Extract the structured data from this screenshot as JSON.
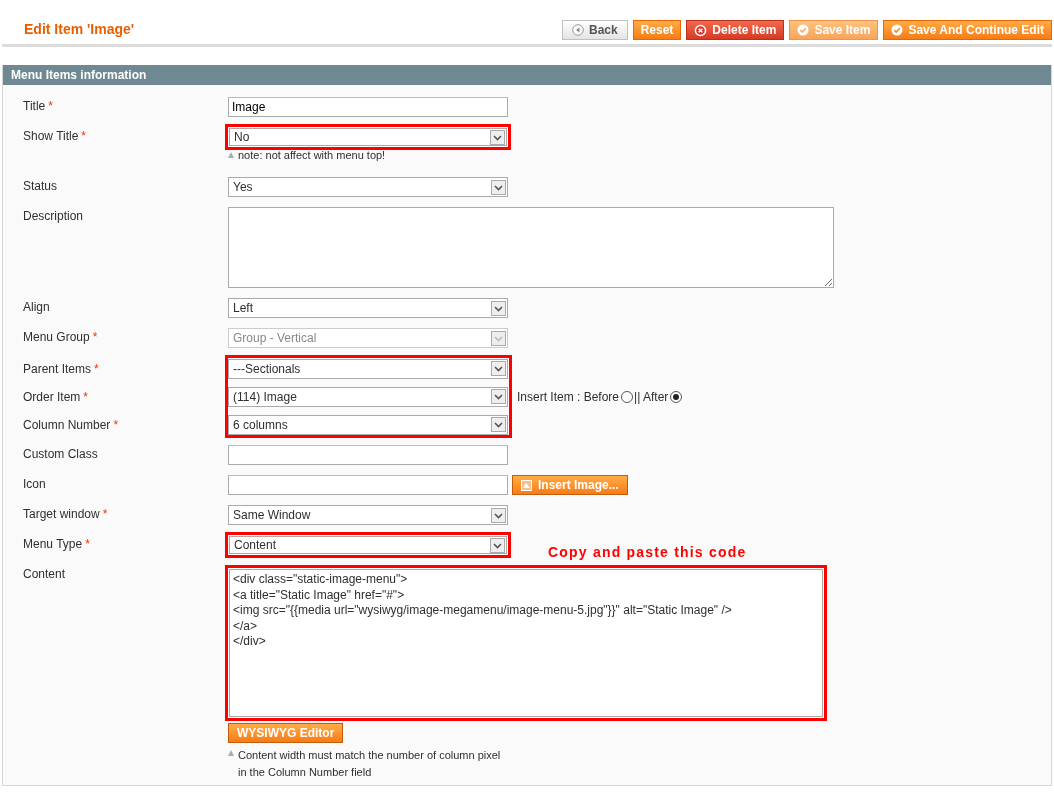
{
  "page_title": "Edit Item 'Image'",
  "buttons": [
    {
      "label": "Back",
      "kind": "back"
    },
    {
      "label": "Reset",
      "kind": "plain"
    },
    {
      "label": "Delete Item",
      "kind": "delete"
    },
    {
      "label": "Save Item",
      "kind": "save",
      "disabled": true
    },
    {
      "label": "Save And Continue Edit",
      "kind": "save",
      "disabled": false
    }
  ],
  "section_title": "Menu Items information",
  "fields": [
    {
      "kind": "text",
      "label": "Title",
      "required_mark": "*",
      "value": "Image",
      "highlighted": false
    },
    {
      "kind": "select",
      "label": "Show Title",
      "required_mark": "*",
      "value": "No",
      "highlighted": true,
      "note": "note: not affect with menu top!"
    },
    {
      "kind": "select",
      "label": "Status",
      "value": "Yes",
      "highlighted": false
    },
    {
      "kind": "textarea",
      "label": "Description",
      "highlighted": false
    },
    {
      "kind": "select",
      "label": "Align",
      "value": "Left",
      "highlighted": false
    },
    {
      "kind": "select",
      "label": "Menu Group",
      "required_mark": "*",
      "value": "Group - Vertical",
      "highlighted": false,
      "disabled": true
    },
    {
      "kind": "group",
      "highlighted": true,
      "children": [
        {
          "kind": "select",
          "label": "Parent Items",
          "required_mark": "*",
          "value": "---Sectionals"
        },
        {
          "kind": "select",
          "label": "Order Item",
          "required_mark": "*",
          "value": "(114) Image",
          "insert": {
            "label": "Insert Item : Before",
            "separator": "|| After",
            "options": [
              {
                "selected": false
              },
              {
                "selected": true
              }
            ]
          }
        },
        {
          "kind": "select",
          "label": "Column Number",
          "required_mark": "*",
          "value": "6 columns"
        }
      ]
    },
    {
      "kind": "text",
      "label": "Custom Class",
      "highlighted": false
    },
    {
      "kind": "text",
      "label": "Icon",
      "highlighted": false,
      "button": "Insert Image..."
    },
    {
      "kind": "select",
      "label": "Target window",
      "required_mark": "*",
      "value": "Same Window",
      "highlighted": false
    },
    {
      "kind": "select",
      "label": "Menu Type",
      "required_mark": "*",
      "value": "Content",
      "highlighted": true
    },
    {
      "kind": "code",
      "label": "Content",
      "highlighted": true,
      "annotation": "Copy and paste this code",
      "value": "<div class=\"static-image-menu\">\n<a title=\"Static Image\" href=\"#\">\n<img src=\"{{media url=\"wysiwyg/image-megamenu/image-menu-5.jpg\"}}\" alt=\"Static Image\" />\n</a>\n</div>",
      "button": "WYSIWYG Editor",
      "note": "Content width must match the number of column pixel in the Column Number field"
    }
  ]
}
